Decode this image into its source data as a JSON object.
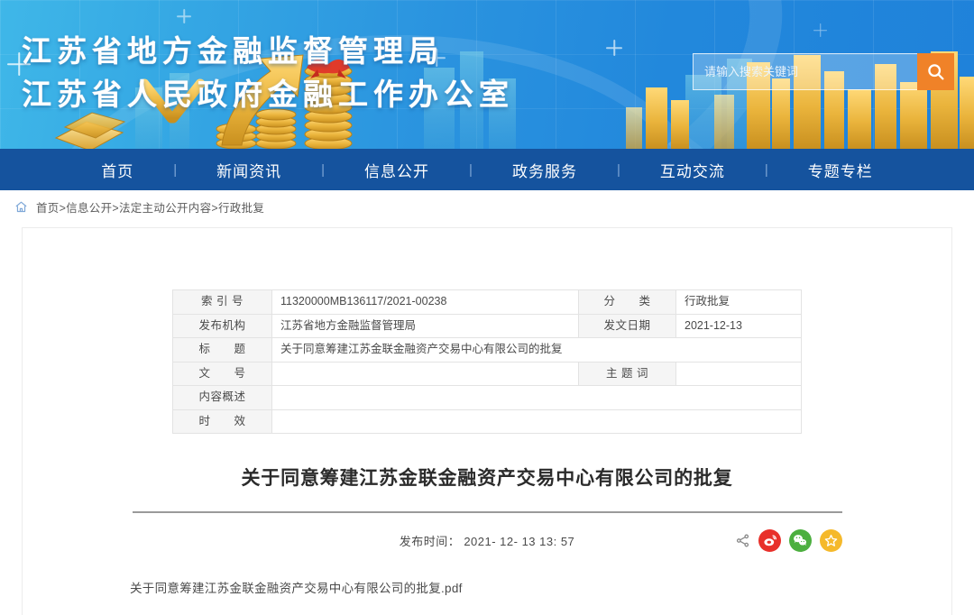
{
  "header": {
    "title_line1": "江苏省地方金融监督管理局",
    "title_line2": "江苏省人民政府金融工作办公室",
    "search": {
      "placeholder": "请输入搜索关键词",
      "value": "",
      "button_icon": "search-icon",
      "button_color": "#f08228"
    }
  },
  "nav": {
    "separator": "|",
    "items": [
      {
        "label": "首页"
      },
      {
        "label": "新闻资讯"
      },
      {
        "label": "信息公开"
      },
      {
        "label": "政务服务"
      },
      {
        "label": "互动交流"
      },
      {
        "label": "专题专栏"
      }
    ]
  },
  "breadcrumb": {
    "home_icon": "home-icon",
    "path": "首页>信息公开>法定主动公开内容>行政批复"
  },
  "info_table": {
    "rows": [
      {
        "label": "索 引 号",
        "value": "11320000MB136117/2021-00238",
        "label2": "分　　类",
        "value2": "行政批复"
      },
      {
        "label": "发布机构",
        "value": "江苏省地方金融监督管理局",
        "label2": "发文日期",
        "value2": "2021-12-13"
      },
      {
        "label": "标　　题",
        "value": "关于同意筹建江苏金联金融资产交易中心有限公司的批复",
        "label2": "",
        "value2": ""
      },
      {
        "label": "文　　号",
        "value": "",
        "label2": "主 题 词",
        "value2": ""
      },
      {
        "label": "内容概述",
        "value": "",
        "label2": "",
        "value2": ""
      },
      {
        "label": "时　　效",
        "value": "",
        "label2": "",
        "value2": ""
      }
    ]
  },
  "document": {
    "title": "关于同意筹建江苏金联金融资产交易中心有限公司的批复",
    "publish_time": "发布时间： 2021- 12- 13 13: 57",
    "attachment": "关于同意筹建江苏金联金融资产交易中心有限公司的批复.pdf",
    "share": [
      {
        "name": "share-icon",
        "color": "transparent",
        "glyph": ""
      },
      {
        "name": "weibo-icon",
        "color": "#e8302a",
        "glyph": ""
      },
      {
        "name": "wechat-icon",
        "color": "#4caf3f",
        "glyph": ""
      },
      {
        "name": "favorite-star-icon",
        "color": "#f5b92b",
        "glyph": "★"
      }
    ]
  }
}
